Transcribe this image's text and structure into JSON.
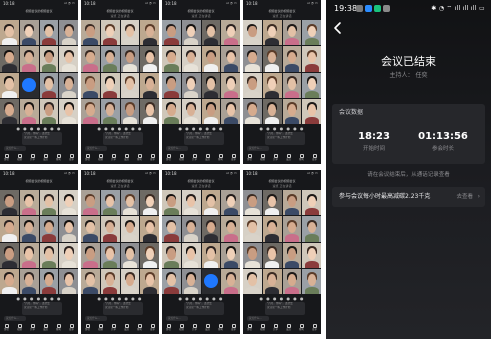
{
  "collage": {
    "screens": [
      {
        "time": "10:18",
        "title": "视频会议的视频会议",
        "sub": "",
        "signal": "ııl ◔ ▭"
      },
      {
        "time": "10:18",
        "title": "视频会议的视频会议",
        "sub": "速览 正在讲话",
        "signal": "ııl ◔ ▭"
      },
      {
        "time": "10:18",
        "title": "视频会议的视频会议",
        "sub": "速览 正在讲话",
        "signal": "ııl ◔ ▭"
      },
      {
        "time": "10:18",
        "title": "视频会议的视频会议",
        "sub": "速览 正在讲话",
        "signal": "ııl ◔ ▭"
      },
      {
        "time": "10:18",
        "title": "视频会议的视频会议",
        "sub": "",
        "signal": "ııl ◔ ▭"
      },
      {
        "time": "10:18",
        "title": "视频会议的视频会议",
        "sub": "速览 正在讲话",
        "signal": "ııl ◔ ▭"
      },
      {
        "time": "10:18",
        "title": "视频会议的视频会议",
        "sub": "速览 正在讲话",
        "signal": "ııl ◔ ▭"
      },
      {
        "time": "10:18",
        "title": "视频会议的视频会议",
        "sub": "速览 正在讲话",
        "signal": "ııl ◔ ▭"
      }
    ],
    "pager_dots": "● ● ● ● ● ● ●",
    "chat_lines": [
      "\"六月，你好\"，这次会",
      "议讨论一些工作计划"
    ],
    "input_placeholder": "说点什么...",
    "tools": [
      "静音",
      "视频",
      "共享",
      "成员",
      "聊天",
      "更多"
    ],
    "avatar_color": "#1f78ff"
  },
  "status_bar": {
    "time": "19:38",
    "right_icons": "✱ ◔ ⌔ ıll ıll ıll ▭",
    "notification_colors": [
      "#7a7a7a",
      "#2b8cff",
      "#19c37d",
      "#8a8a8a"
    ]
  },
  "back_icon": "chevron-left-icon",
  "meeting_end": {
    "title": "会议已结束",
    "host": "主持人： 任奕"
  },
  "meeting_data": {
    "section_title": "会议数据",
    "start_time": "18:23",
    "start_label": "开始时间",
    "duration": "01:13:56",
    "duration_label": "参会时长"
  },
  "hint": "请在会议结束后，从通话记录查看",
  "carbon": {
    "text": "参与会议每小时最高减碳2.23千克",
    "link": "去查看",
    "chevron": "›"
  }
}
